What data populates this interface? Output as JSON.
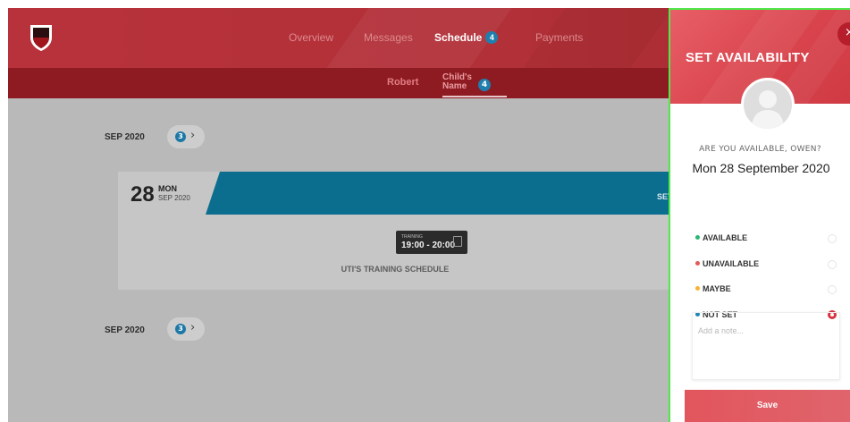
{
  "header": {
    "nav": [
      {
        "label": "Overview"
      },
      {
        "label": "Messages"
      },
      {
        "label": "Schedule",
        "badge": "4"
      },
      {
        "label": "Payments"
      }
    ],
    "subnav": [
      {
        "label": "Robert"
      },
      {
        "label_line1": "Child's",
        "label_line2": "Name",
        "badge": "4"
      }
    ]
  },
  "schedule": {
    "groups": [
      {
        "month": "SEP 2020",
        "count": "3"
      },
      {
        "month": "SEP 2020",
        "count": "3"
      }
    ],
    "event": {
      "day": "28",
      "dow": "MON",
      "month_year": "SEP 2020",
      "set_label": "SET",
      "type": "TRAINING",
      "time": "19:00 - 20:00",
      "title": "UTI'S TRAINING SCHEDULE"
    }
  },
  "panel": {
    "title": "SET AVAILABILITY",
    "close_label": "×",
    "question": "ARE YOU AVAILABLE, OWEN?",
    "date": "Mon 28 September 2020",
    "options": [
      {
        "label": "AVAILABLE",
        "color": "#2bb673",
        "selected": false
      },
      {
        "label": "UNAVAILABLE",
        "color": "#e25b5b",
        "selected": false
      },
      {
        "label": "MAYBE",
        "color": "#f5b335",
        "selected": false
      },
      {
        "label": "NOT SET",
        "color": "#1d87b5",
        "selected": true
      }
    ],
    "note_placeholder": "Add a note...",
    "save_label": "Save"
  },
  "colors": {
    "brand_red": "#b8323b",
    "accent_teal": "#0c6e8f",
    "focus_outline": "#51e84a"
  }
}
